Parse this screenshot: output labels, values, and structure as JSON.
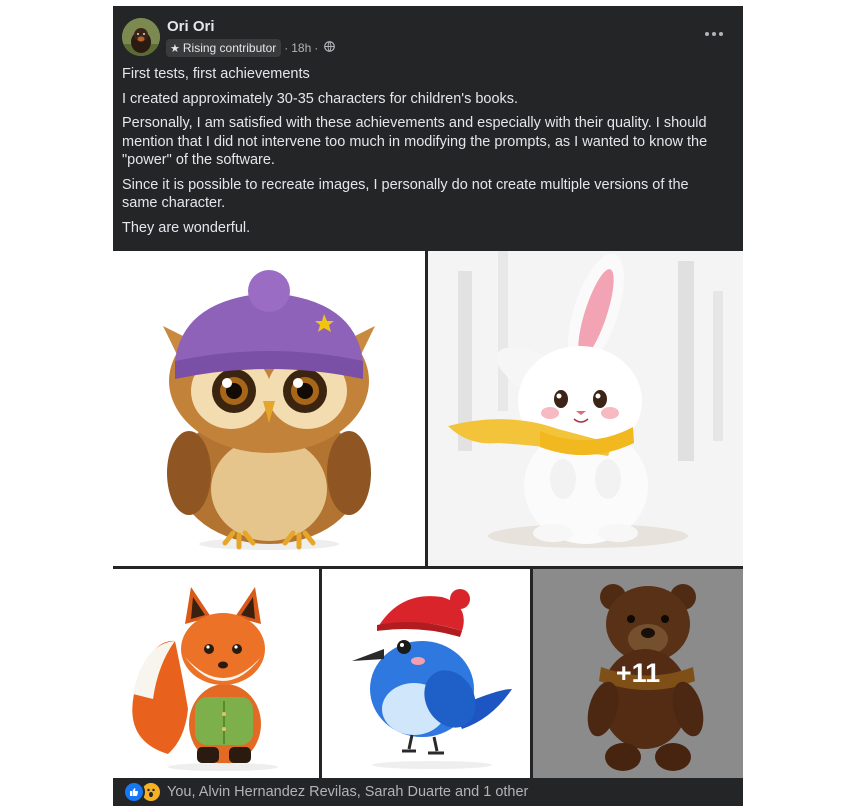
{
  "post": {
    "author": "Ori Ori",
    "badge_label": "Rising contributor",
    "timestamp": "18h",
    "separator": "·",
    "paragraphs": [
      "First tests, first achievements",
      "I created approximately 30-35 characters for children's books.",
      "Personally, I am satisfied with these achievements and especially with their quality. I should mention that I did not intervene too much in modifying the prompts, as I wanted to know the \"power\" of the software.",
      "Since it is possible to recreate images, I personally do not create multiple versions of the same character.",
      "They are wonderful."
    ],
    "more_photos_label": "+11",
    "reactions_text": "You, Alvin Hernandez Revilas, Sarah Duarte and 1 other",
    "reaction_icons": [
      "like-icon",
      "wow-icon"
    ]
  },
  "theme": {
    "card_bg": "#242526",
    "text": "#e4e6eb",
    "secondary_text": "#b0b3b8",
    "like_blue": "#1877f2",
    "wow_yellow": "#f7b125"
  }
}
